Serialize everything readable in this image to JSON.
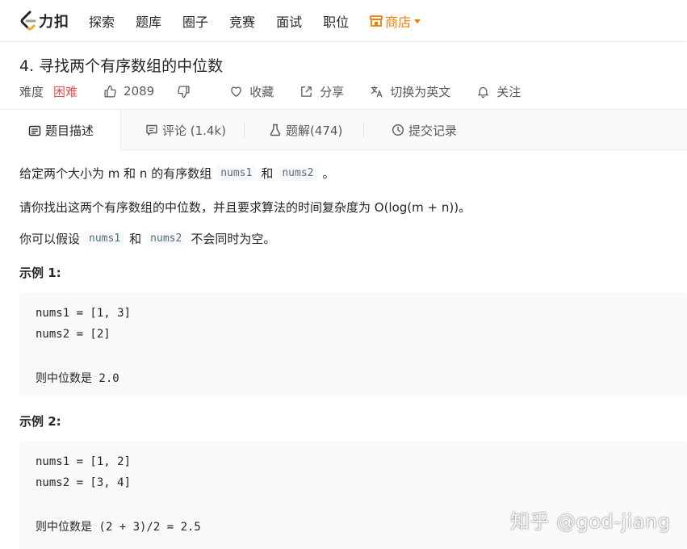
{
  "nav": {
    "logo_text": "力扣",
    "items": [
      "探索",
      "题库",
      "圈子",
      "竞赛",
      "面试",
      "职位"
    ],
    "store_label": "商店",
    "accent_color": "#f57c00"
  },
  "problem": {
    "title": "4. 寻找两个有序数组的中位数",
    "difficulty_label": "难度",
    "difficulty": "困难",
    "difficulty_color": "#ec4c47",
    "likes": "2089",
    "favorite_label": "收藏",
    "share_label": "分享",
    "switch_lang_label": "切换为英文",
    "follow_label": "关注"
  },
  "tabs": [
    {
      "label": "题目描述",
      "icon": "description-icon"
    },
    {
      "label": "评论 (1.4k)",
      "icon": "comment-icon"
    },
    {
      "label": "题解(474)",
      "icon": "flask-icon"
    },
    {
      "label": "提交记录",
      "icon": "clock-icon"
    }
  ],
  "description": {
    "p1": {
      "before": "给定两个大小为 m 和 n 的有序数组",
      "code1": "nums1",
      "mid": "和",
      "code2": "nums2",
      "after": "。"
    },
    "p2": "请你找出这两个有序数组的中位数，并且要求算法的时间复杂度为 O(log(m + n))。",
    "p3": {
      "before": "你可以假设",
      "code1": "nums1",
      "mid": "和",
      "code2": "nums2",
      "after": "不会同时为空。"
    }
  },
  "examples": [
    {
      "title": "示例 1:",
      "lines": [
        "nums1 = [1, 3]",
        "nums2 = [2]",
        "",
        "则中位数是 2.0"
      ]
    },
    {
      "title": "示例 2:",
      "lines": [
        "nums1 = [1, 2]",
        "nums2 = [3, 4]",
        "",
        "则中位数是 (2 + 3)/2 = 2.5"
      ]
    }
  ],
  "watermark": "知乎 @god-jiang"
}
